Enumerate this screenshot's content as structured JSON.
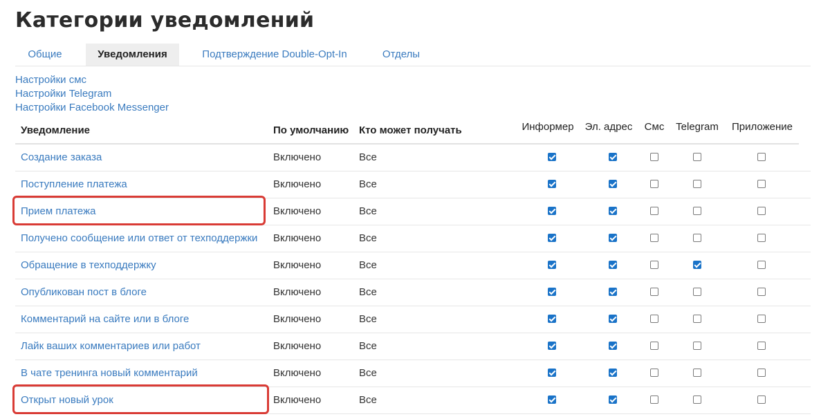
{
  "page": {
    "title": "Категории уведомлений"
  },
  "tabs": [
    {
      "label": "Общие",
      "active": false
    },
    {
      "label": "Уведомления",
      "active": true
    },
    {
      "label": "Подтверждение Double-Opt-In",
      "active": false
    },
    {
      "label": "Отделы",
      "active": false
    }
  ],
  "settings_links": [
    "Настройки смс",
    "Настройки Telegram",
    "Настройки Facebook Messenger"
  ],
  "table": {
    "headers": {
      "notification": "Уведомление",
      "default": "По умолчанию",
      "recipients": "Кто может получать",
      "informer": "Информер",
      "email": "Эл. адрес",
      "sms": "Смс",
      "telegram": "Telegram",
      "app": "Приложение"
    },
    "rows": [
      {
        "name": "Создание заказа",
        "default": "Включено",
        "recipients": "Все",
        "informer": true,
        "email": true,
        "sms": false,
        "telegram": false,
        "app": false
      },
      {
        "name": "Поступление платежа",
        "default": "Включено",
        "recipients": "Все",
        "informer": true,
        "email": true,
        "sms": false,
        "telegram": false,
        "app": false
      },
      {
        "name": "Прием платежа",
        "default": "Включено",
        "recipients": "Все",
        "informer": true,
        "email": true,
        "sms": false,
        "telegram": false,
        "app": false,
        "highlighted": true
      },
      {
        "name": "Получено сообщение или ответ от техподдержки",
        "default": "Включено",
        "recipients": "Все",
        "informer": true,
        "email": true,
        "sms": false,
        "telegram": false,
        "app": false
      },
      {
        "name": "Обращение в техподдержку",
        "default": "Включено",
        "recipients": "Все",
        "informer": true,
        "email": true,
        "sms": false,
        "telegram": true,
        "app": false
      },
      {
        "name": "Опубликован пост в блоге",
        "default": "Включено",
        "recipients": "Все",
        "informer": true,
        "email": true,
        "sms": false,
        "telegram": false,
        "app": false
      },
      {
        "name": "Комментарий на сайте или в блоге",
        "default": "Включено",
        "recipients": "Все",
        "informer": true,
        "email": true,
        "sms": false,
        "telegram": false,
        "app": false
      },
      {
        "name": "Лайк ваших комментариев или работ",
        "default": "Включено",
        "recipients": "Все",
        "informer": true,
        "email": true,
        "sms": false,
        "telegram": false,
        "app": false
      },
      {
        "name": "В чате тренинга новый комментарий",
        "default": "Включено",
        "recipients": "Все",
        "informer": true,
        "email": true,
        "sms": false,
        "telegram": false,
        "app": false
      },
      {
        "name": "Открыт новый урок",
        "default": "Включено",
        "recipients": "Все",
        "informer": true,
        "email": true,
        "sms": false,
        "telegram": false,
        "app": false,
        "highlighted": true
      }
    ]
  },
  "colors": {
    "link": "#3a7bbf",
    "checkbox_checked": "#1a73c8",
    "highlight": "#d93b35"
  }
}
